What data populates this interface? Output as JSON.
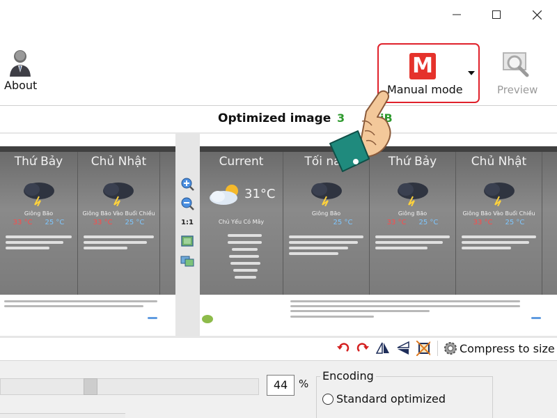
{
  "window": {
    "controls": [
      "minimize-icon",
      "maximize-icon",
      "close-icon"
    ]
  },
  "toolbar": {
    "about_label": "About",
    "manual_icon_letter": "M",
    "manual_label": "Manual mode",
    "preview_label": "Preview"
  },
  "header": {
    "title": "Optimized image",
    "size_partial_left": "3",
    "size_partial_right": "iB"
  },
  "preview_left": {
    "cards": [
      {
        "title": "Thứ Bảy",
        "condition": "Giông Bão",
        "high": "33 °C",
        "low": "25 °C"
      },
      {
        "title": "Chủ Nhật",
        "condition": "Giông Bão Vào Buổi Chiều",
        "high": "33 °C",
        "low": "25 °C"
      }
    ]
  },
  "preview_right": {
    "current_title": "Current",
    "current_temp": "31°C",
    "current_condition": "Chủ Yếu Có Mây",
    "cards": [
      {
        "title": "Tối nay",
        "condition": "Giông Bão",
        "high": "",
        "low": "25 °C"
      },
      {
        "title": "Thứ Bảy",
        "condition": "Giông Bão",
        "high": "33 °C",
        "low": "25 °C"
      },
      {
        "title": "Chủ Nhật",
        "condition": "Giông Bão Vào Buổi Chiều",
        "high": "33 °C",
        "low": "25 °C"
      }
    ]
  },
  "side_tools": {
    "ratio_label": "1:1"
  },
  "bottom_toolbar": {
    "compress_label": "Compress to size"
  },
  "settings": {
    "quality_value": "44",
    "quality_unit": "%",
    "slider_level_percent": 34,
    "encoding_label": "Encoding",
    "encoding_option": "Standard optimized"
  },
  "colors": {
    "accent_red": "#e0212b",
    "size_green": "#2e9a2e",
    "hand_teal": "#1f8a7d",
    "hand_skin": "#f3c89a"
  }
}
